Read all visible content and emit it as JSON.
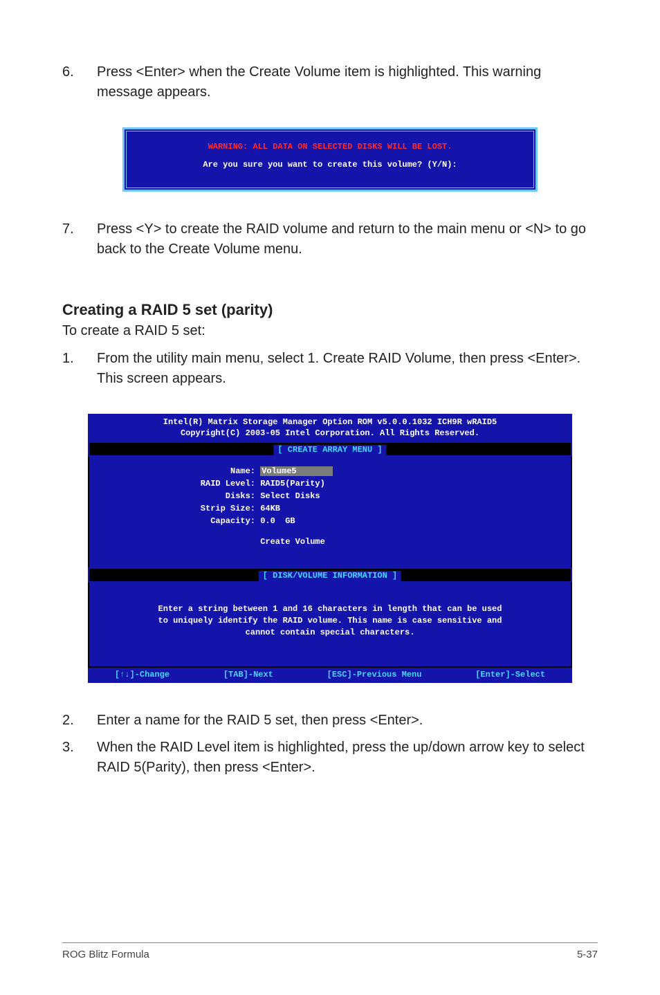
{
  "step6": {
    "num": "6.",
    "text": "Press <Enter> when the Create Volume item is highlighted. This warning message appears."
  },
  "warn": {
    "line1": "WARNING: ALL DATA ON SELECTED DISKS WILL BE LOST.",
    "line2": "Are you sure you want to create this volume? (Y/N):"
  },
  "step7": {
    "num": "7.",
    "text": "Press <Y> to create the RAID volume and return to the main menu or <N> to go back to the Create Volume menu."
  },
  "section": {
    "title": "Creating a RAID 5 set (parity)",
    "sub": "To create a RAID 5 set:"
  },
  "step1": {
    "num": "1.",
    "text": "From the utility main menu, select 1. Create RAID Volume, then press <Enter>. This screen appears."
  },
  "bios": {
    "hdr1": "Intel(R) Matrix Storage Manager Option ROM v5.0.0.1032 ICH9R wRAID5",
    "hdr2": "Copyright(C) 2003-05 Intel Corporation. All Rights Reserved.",
    "legend1": "[ CREATE ARRAY MENU ]",
    "form": {
      "name_label": "            Name:",
      "name_value": "Volume5",
      "raid_label": "      RAID Level:",
      "raid_value": "RAID5(Parity)",
      "disks_label": "           Disks:",
      "disks_value": "Select Disks",
      "strip_label": "      Strip Size:",
      "strip_value": "64KB",
      "cap_label": "        Capacity:",
      "cap_value": "0.0  GB",
      "create": "Create Volume"
    },
    "legend2": "[ DISK/VOLUME INFORMATION ]",
    "info1": "Enter a string between 1 and 16 characters in length that can be used",
    "info2": "to uniquely identify the RAID volume. This name is case sensitive and",
    "info3": "cannot contain special characters.",
    "keys": {
      "k1": "[↑↓]-Change",
      "k2": "[TAB]-Next",
      "k3": "[ESC]-Previous Menu",
      "k4": "[Enter]-Select"
    }
  },
  "step2": {
    "num": "2.",
    "text": "Enter a name for the RAID 5 set, then press <Enter>."
  },
  "step3": {
    "num": "3.",
    "text": "When the RAID Level item is highlighted, press the up/down arrow key to select RAID 5(Parity), then press <Enter>."
  },
  "footer": {
    "left": "ROG Blitz Formula",
    "right": "5-37"
  }
}
